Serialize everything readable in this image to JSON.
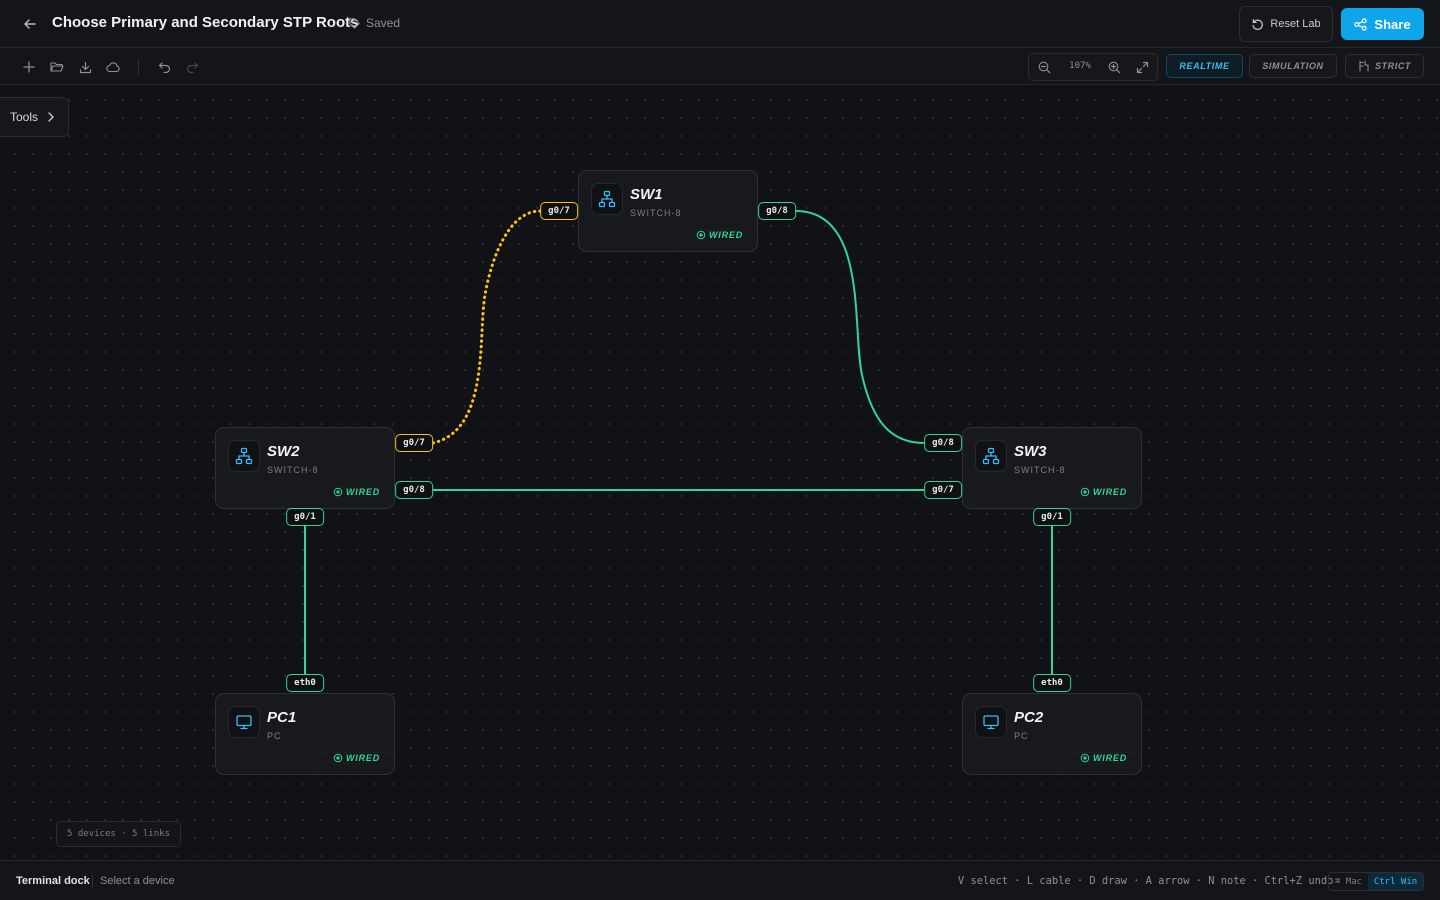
{
  "header": {
    "title": "Choose Primary and Secondary STP Roots",
    "saved_label": "Saved",
    "reset_label": "Reset Lab",
    "share_label": "Share"
  },
  "toolbar": {
    "zoom": "107%",
    "modes": {
      "realtime": "REALTIME",
      "simulation": "SIMULATION",
      "strict": "STRICT"
    },
    "active_mode": "REALTIME",
    "icons": [
      "plus-icon",
      "folder-open-icon",
      "download-icon",
      "cloud-icon",
      "undo-icon",
      "redo-icon",
      "zoom-out-icon",
      "zoom-in-icon",
      "fullscreen-icon"
    ]
  },
  "canvas": {
    "tools_label": "Tools",
    "stats": "5 devices · 5 links",
    "devices": {
      "sw1": {
        "name": "SW1",
        "model": "SWITCH-8",
        "status": "WIRED"
      },
      "sw2": {
        "name": "SW2",
        "model": "SWITCH-8",
        "status": "WIRED"
      },
      "sw3": {
        "name": "SW3",
        "model": "SWITCH-8",
        "status": "WIRED"
      },
      "pc1": {
        "name": "PC1",
        "model": "PC",
        "status": "WIRED"
      },
      "pc2": {
        "name": "PC2",
        "model": "PC",
        "status": "WIRED"
      }
    },
    "ports": {
      "sw1_g07": "g0/7",
      "sw1_g08": "g0/8",
      "sw2_g07": "g0/7",
      "sw2_g08": "g0/8",
      "sw2_g01": "g0/1",
      "sw3_g08": "g0/8",
      "sw3_g07": "g0/7",
      "sw3_g01": "g0/1",
      "pc1_eth0": "eth0",
      "pc2_eth0": "eth0"
    },
    "link_colors": {
      "forwarding": "#34d399",
      "blocked": "#fbbf24"
    }
  },
  "footer": {
    "dock_title": "Terminal dock",
    "dock_hint": "Select a device",
    "shortcuts": "V select · L cable · D draw · A arrow · N note · Ctrl+Z undo",
    "os_mac": "⌘ Mac",
    "os_win": "Ctrl Win"
  }
}
